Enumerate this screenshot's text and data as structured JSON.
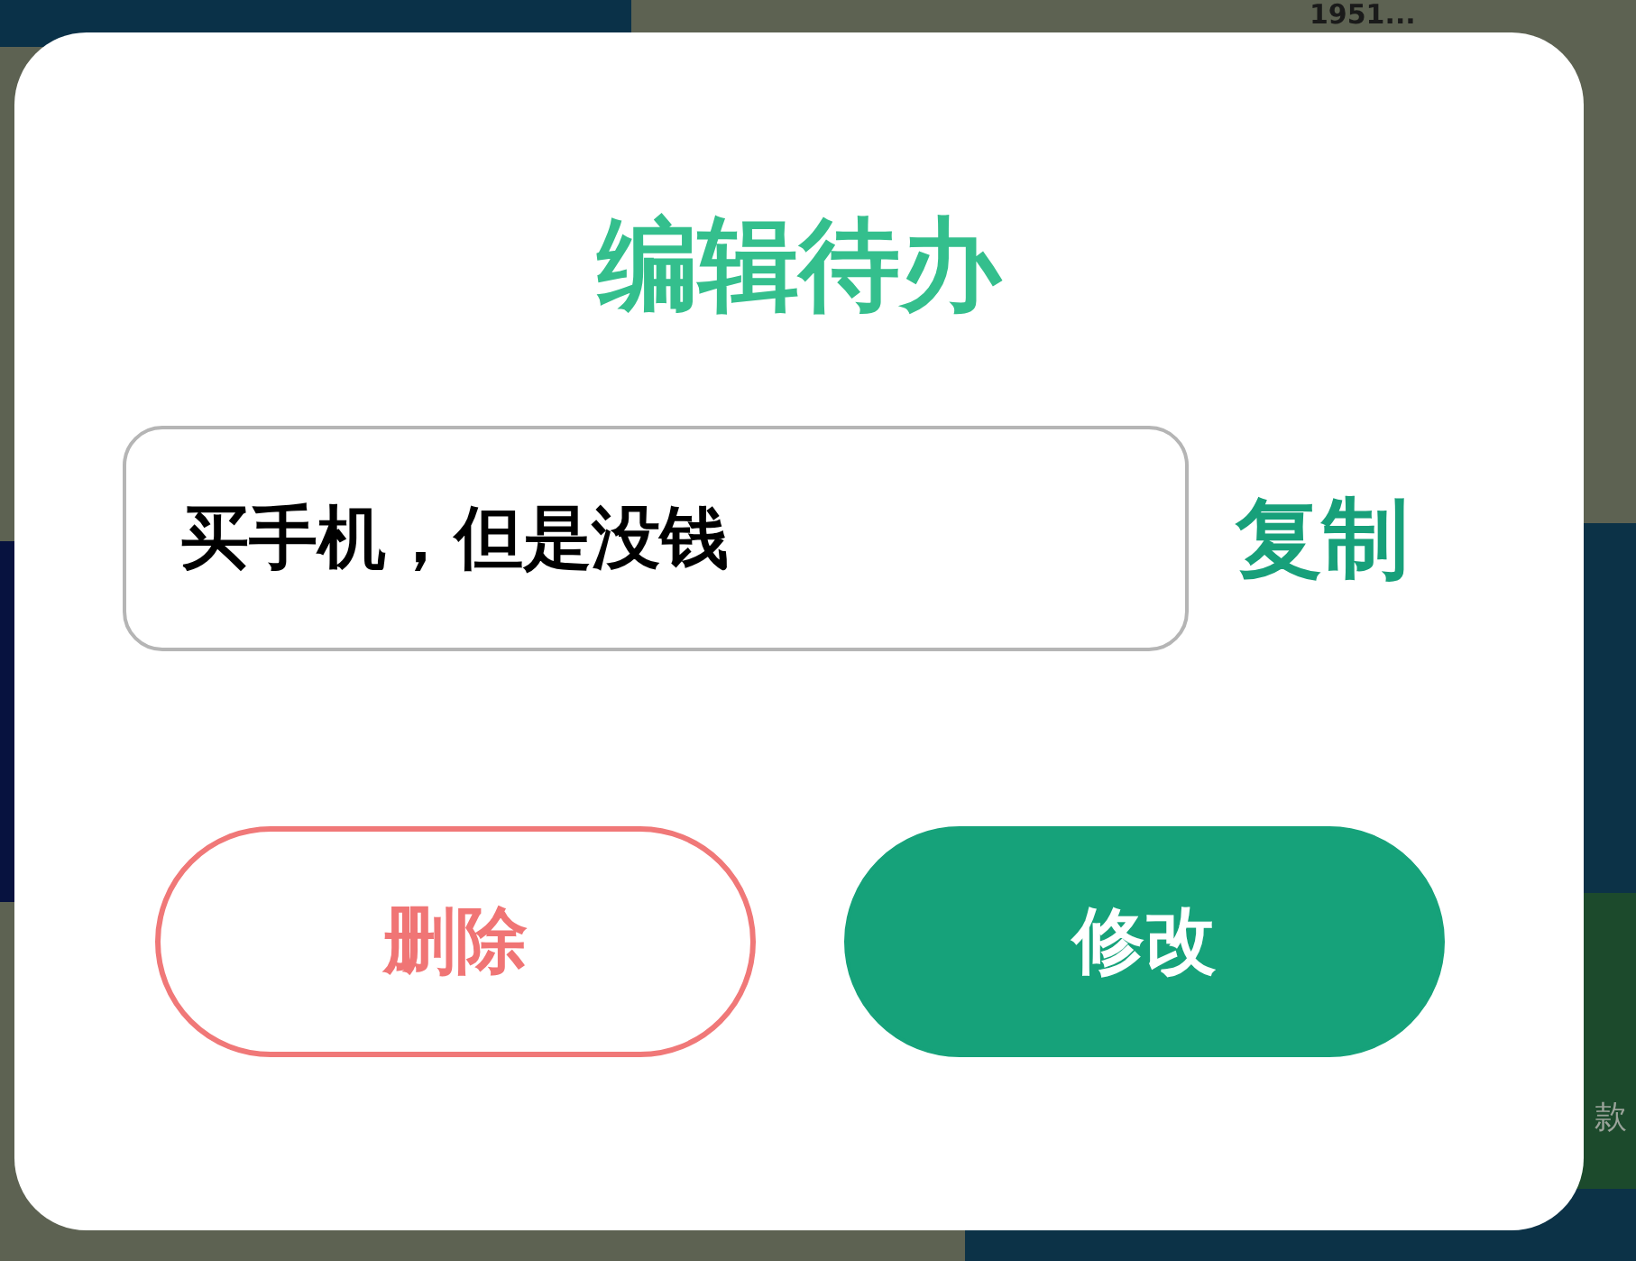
{
  "background": {
    "header_text": "1951...",
    "side_text": "款"
  },
  "dialog": {
    "title": "编辑待办",
    "todo_field": {
      "value": "买手机，但是没钱"
    },
    "copy_link": "复制",
    "buttons": [
      {
        "kind": "outline",
        "label": "删除"
      },
      {
        "kind": "filled",
        "label": "修改"
      }
    ]
  }
}
